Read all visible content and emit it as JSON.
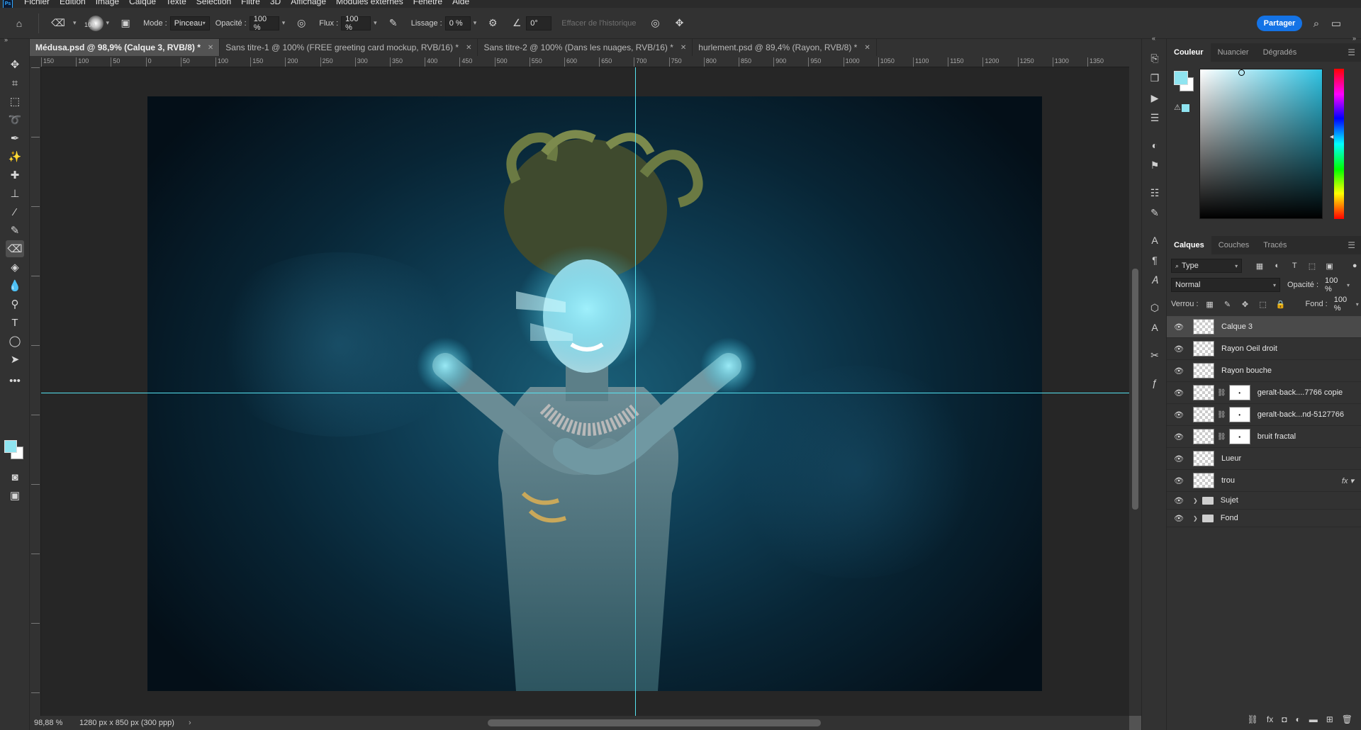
{
  "menubar": {
    "logo": "Ps",
    "items": [
      "Fichier",
      "Edition",
      "Image",
      "Calque",
      "Texte",
      "Sélection",
      "Filtre",
      "3D",
      "Affichage",
      "Modules externes",
      "Fenêtre",
      "Aide"
    ]
  },
  "options": {
    "brush_size": "100",
    "mode_label": "Mode :",
    "mode_value": "Pinceau",
    "opacity_label": "Opacité :",
    "opacity_value": "100 %",
    "flow_label": "Flux :",
    "flow_value": "100 %",
    "smoothing_label": "Lissage :",
    "smoothing_value": "0 %",
    "angle_value": "0°",
    "erase_history_label": "Effacer de l'historique",
    "share_label": "Partager"
  },
  "tabs": [
    {
      "label": "Médusa.psd @ 98,9% (Calque 3, RVB/8) *",
      "active": true
    },
    {
      "label": "Sans titre-1 @ 100% (FREE greeting card mockup, RVB/16) *",
      "active": false
    },
    {
      "label": "Sans titre-2 @ 100% (Dans les nuages, RVB/16) *",
      "active": false
    },
    {
      "label": "hurlement.psd @ 89,4% (Rayon, RVB/8) *",
      "active": false
    }
  ],
  "ruler_h": [
    "150",
    "100",
    "50",
    "0",
    "50",
    "100",
    "150",
    "200",
    "250",
    "300",
    "350",
    "400",
    "450",
    "500",
    "550",
    "600",
    "650",
    "700",
    "750",
    "800",
    "850",
    "900",
    "950",
    "1000",
    "1050",
    "1100",
    "1150",
    "1200",
    "1250",
    "1300",
    "1350"
  ],
  "status": {
    "zoom": "98,88 %",
    "doc_info": "1280 px x 850 px (300 ppp)"
  },
  "color_panel": {
    "tabs": [
      "Couleur",
      "Nuancier",
      "Dégradés"
    ],
    "fg_color": "#8fe4f0",
    "bg_color": "#ffffff",
    "hue_color": "#2fc3e3"
  },
  "layers_panel": {
    "tabs": [
      "Calques",
      "Couches",
      "Tracés"
    ],
    "filter_value": "Type",
    "blend_mode": "Normal",
    "opacity_label": "Opacité :",
    "opacity_value": "100 %",
    "lock_label": "Verrou :",
    "fill_label": "Fond :",
    "fill_value": "100 %",
    "layers": [
      {
        "name": "Calque 3",
        "selected": true,
        "type": "pixel"
      },
      {
        "name": "Rayon Oeil droit",
        "selected": false,
        "type": "pixel"
      },
      {
        "name": "Rayon bouche",
        "selected": false,
        "type": "pixel"
      },
      {
        "name": "geralt-back....7766 copie",
        "selected": false,
        "type": "masked"
      },
      {
        "name": "geralt-back...nd-5127766",
        "selected": false,
        "type": "masked"
      },
      {
        "name": "bruit fractal",
        "selected": false,
        "type": "masked"
      },
      {
        "name": "Lueur",
        "selected": false,
        "type": "pixel"
      },
      {
        "name": "trou",
        "selected": false,
        "type": "fx"
      },
      {
        "name": "Sujet",
        "selected": false,
        "type": "group"
      },
      {
        "name": "Fond",
        "selected": false,
        "type": "group"
      }
    ]
  },
  "icons": {
    "tools": [
      "move-icon",
      "crop-icon",
      "marquee-icon",
      "lasso-icon",
      "quick-select-icon",
      "eyedropper-icon",
      "healing-icon",
      "stamp-icon",
      "brush-history-icon",
      "brush-icon",
      "eraser-icon",
      "paint-bucket-icon",
      "blur-icon",
      "dodge-icon",
      "type-icon",
      "ellipse-icon",
      "path-select-icon",
      "more-tools-icon"
    ]
  }
}
